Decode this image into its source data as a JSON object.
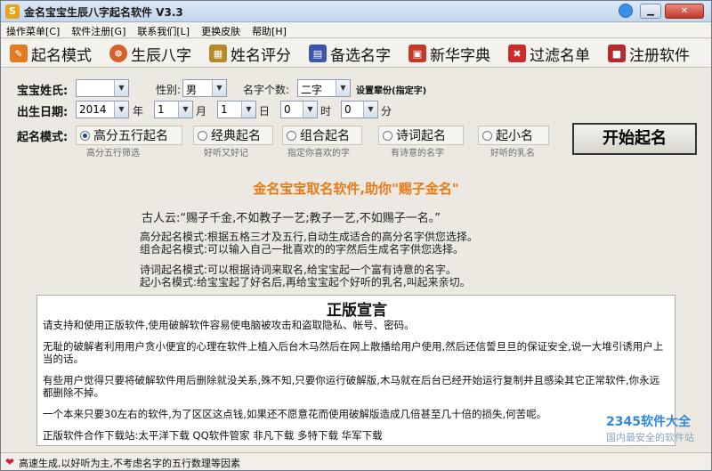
{
  "window": {
    "title": "金名宝宝生辰八字起名软件 V3.3",
    "icon_letter": "S"
  },
  "menu": [
    "操作菜单[C]",
    "软件注册[G]",
    "联系我们[L]",
    "更换皮肤",
    "帮助[H]"
  ],
  "toolbar": [
    {
      "label": "起名模式",
      "icon": "name-mode-icon",
      "color": "#e07b1f"
    },
    {
      "label": "生辰八字",
      "icon": "bazi-icon",
      "color": "#d4612a"
    },
    {
      "label": "姓名评分",
      "icon": "score-icon",
      "color": "#b78a2a"
    },
    {
      "label": "备选名字",
      "icon": "calendar-icon",
      "color": "#3d57a8"
    },
    {
      "label": "新华字典",
      "icon": "dictionary-icon",
      "color": "#c0392b"
    },
    {
      "label": "过滤名单",
      "icon": "filter-icon",
      "color": "#cc2b2b"
    },
    {
      "label": "注册软件",
      "icon": "lock-icon",
      "color": "#b52a2a"
    }
  ],
  "form": {
    "surname_label": "宝宝姓氏:",
    "surname_value": "",
    "gender_label": "性别:",
    "gender_value": "男",
    "name_count_label": "名字个数:",
    "name_count_value": "二字",
    "generation_label": "设置辈份(指定字)",
    "birth_label": "出生日期:",
    "year_value": "2014",
    "year_unit": "年",
    "month_value": "1",
    "month_unit": "月",
    "day_value": "1",
    "day_unit": "日",
    "hour_value": "0",
    "hour_unit": "时",
    "minute_value": "0",
    "minute_unit": "分",
    "mode_label": "起名模式:"
  },
  "modes": [
    {
      "label": "高分五行起名",
      "sub": "高分五行筛选",
      "selected": true
    },
    {
      "label": "经典起名",
      "sub": "好听又好记",
      "selected": false
    },
    {
      "label": "组合起名",
      "sub": "指定你喜欢的字",
      "selected": false
    },
    {
      "label": "诗词起名",
      "sub": "有诗意的名字",
      "selected": false
    },
    {
      "label": "起小名",
      "sub": "好听的乳名",
      "selected": false
    }
  ],
  "start_button": "开始起名",
  "content": {
    "headline": "金名宝宝取名软件,助你\"赐子金名\"",
    "quote": "古人云:“赐子千金,不如教子一艺;教子一艺,不如赐子一名。”",
    "line1": "高分起名模式:根据五格三才及五行,自动生成适合的高分名字供您选择。",
    "line2": "组合起名模式:可以输入自己一批喜欢的的字然后生成名字供您选择。",
    "line3": "诗词起名模式:可以根据诗词来取名,给宝宝起一个富有诗意的名字。",
    "line4": "起小名模式:给宝宝起了好名后,再给宝宝起个好听的乳名,叫起来亲切。"
  },
  "notice": {
    "title": "正版宣言",
    "p1": "请支持和使用正版软件,使用破解软件容易使电脑被攻击和盗取隐私、帐号、密码。",
    "p2": "无耻的破解者利用用户贪小便宜的心理在软件上植入后台木马然后在网上散播给用户使用,然后还信誓旦旦的保证安全,说一大堆引诱用户上当的话。",
    "p3": "有些用户觉得只要将破解软件用后删除就没关系,殊不知,只要你运行破解版,木马就在后台已经开始运行复制并且感染其它正常软件,你永远都删除不掉。",
    "p4": "一个本来只要30左右的软件,为了区区这点钱,如果还不愿意花而使用破解版造成几倍甚至几十倍的损失,何苦呢。",
    "p5": "正版软件合作下载站:太平洋下载  QQ软件管家  非凡下载  多特下载  华军下载"
  },
  "watermark": {
    "line1": "2345软件大全",
    "line2": "国内最安全的软件站"
  },
  "status": {
    "text": "高速生成,以好听为主,不考虑名字的五行数理等因素"
  }
}
